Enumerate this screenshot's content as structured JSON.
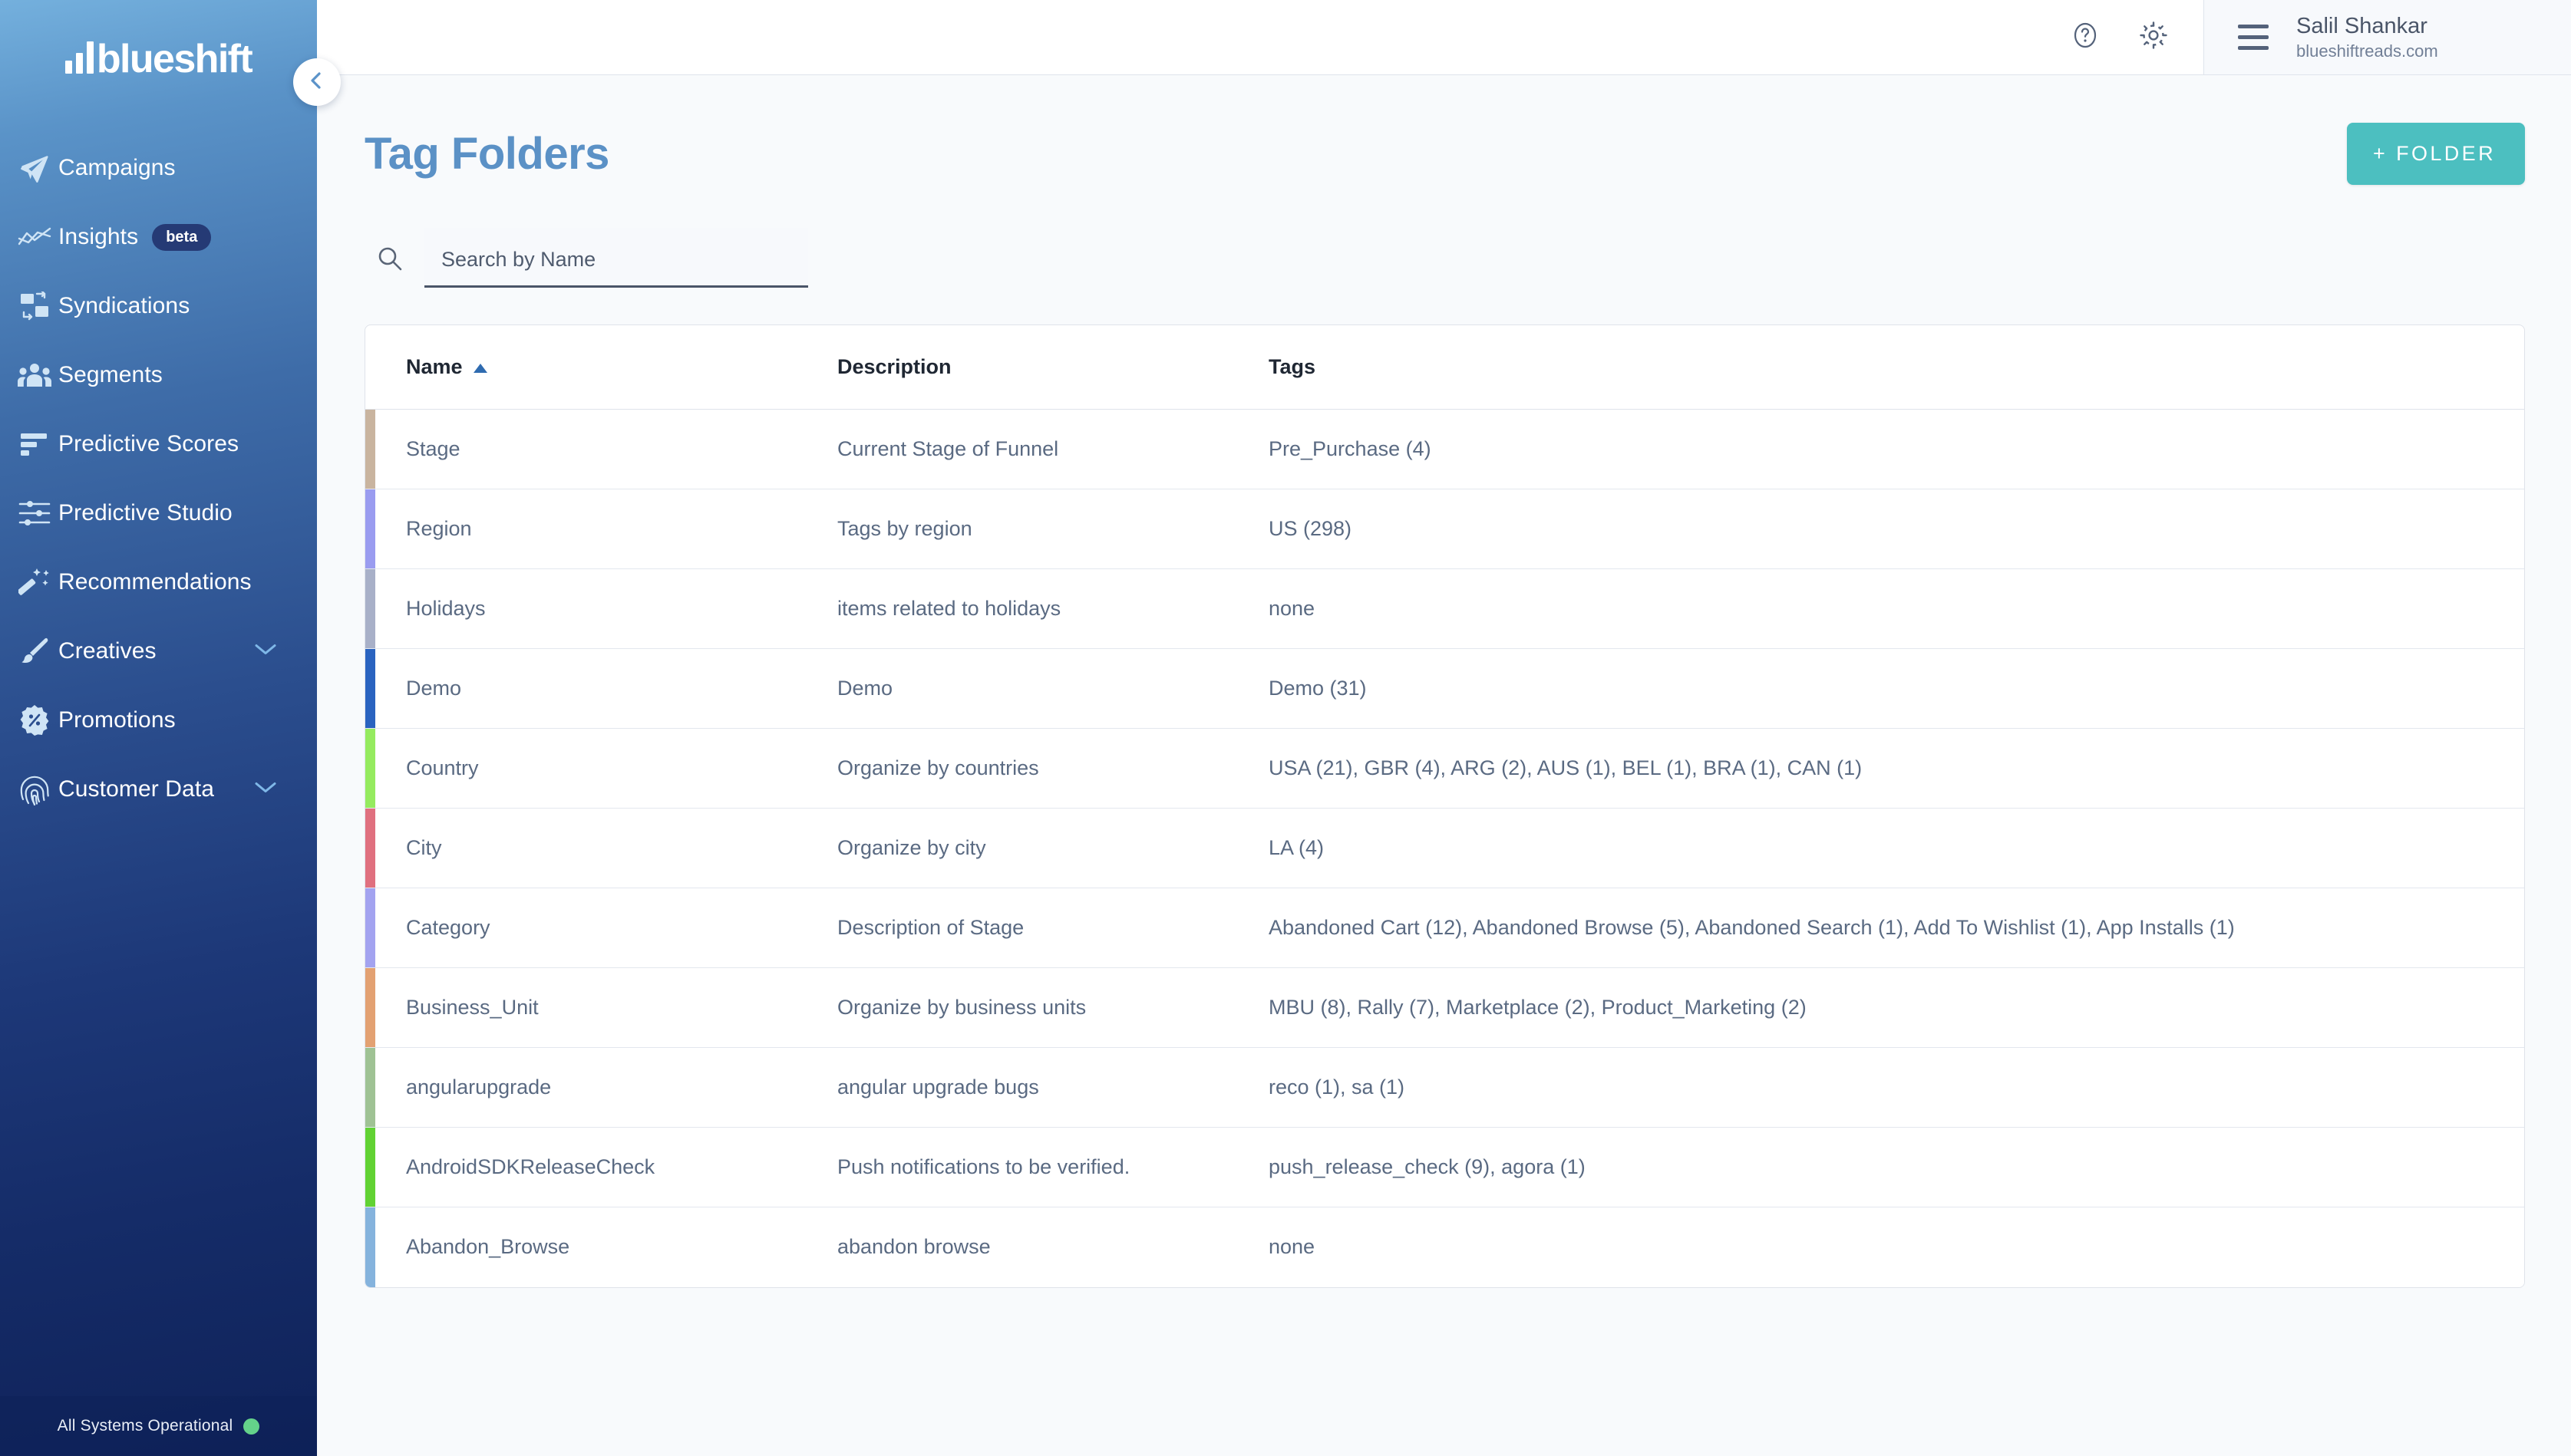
{
  "brand": {
    "name": "blueshift",
    "logo_icon": "bar-chart-logo-icon"
  },
  "sidebar": {
    "items": [
      {
        "label": "Campaigns",
        "icon": "paper-plane-icon",
        "badge": null,
        "caret": false
      },
      {
        "label": "Insights",
        "icon": "line-chart-icon",
        "badge": "beta",
        "caret": false
      },
      {
        "label": "Syndications",
        "icon": "syndication-icon",
        "badge": null,
        "caret": false
      },
      {
        "label": "Segments",
        "icon": "people-group-icon",
        "badge": null,
        "caret": false
      },
      {
        "label": "Predictive Scores",
        "icon": "bar-list-icon",
        "badge": null,
        "caret": false
      },
      {
        "label": "Predictive Studio",
        "icon": "sliders-icon",
        "badge": null,
        "caret": false
      },
      {
        "label": "Recommendations",
        "icon": "magic-wand-icon",
        "badge": null,
        "caret": false
      },
      {
        "label": "Creatives",
        "icon": "paintbrush-icon",
        "badge": null,
        "caret": true
      },
      {
        "label": "Promotions",
        "icon": "percent-badge-icon",
        "badge": null,
        "caret": false
      },
      {
        "label": "Customer Data",
        "icon": "fingerprint-icon",
        "badge": null,
        "caret": true
      }
    ],
    "collapse_icon": "chevron-left-icon",
    "status": {
      "text": "All Systems Operational",
      "dot_color": "#64d28a"
    }
  },
  "topbar": {
    "help_icon": "question-circle-icon",
    "settings_icon": "gear-icon",
    "menu_icon": "hamburger-icon",
    "user_name": "Salil Shankar",
    "user_site": "blueshiftreads.com"
  },
  "page": {
    "title": "Tag Folders",
    "add_button_label": "+ FOLDER",
    "add_button_color": "#4cbfc0",
    "title_color": "#5b91c6"
  },
  "search": {
    "placeholder": "Search by Name",
    "value": "",
    "icon": "search-icon"
  },
  "table": {
    "columns": [
      {
        "key": "name",
        "label": "Name",
        "sorted": true,
        "sort_dir": "asc",
        "sort_icon": "caret-up-icon"
      },
      {
        "key": "description",
        "label": "Description",
        "sorted": false,
        "sort_dir": null,
        "sort_icon": null
      },
      {
        "key": "tags",
        "label": "Tags",
        "sorted": false,
        "sort_dir": null,
        "sort_icon": null
      }
    ],
    "rows": [
      {
        "color": "#c9b49f",
        "name": "Stage",
        "description": "Current Stage of Funnel",
        "tags": "Pre_Purchase (4)"
      },
      {
        "color": "#9a9cf0",
        "name": "Region",
        "description": "Tags by region",
        "tags": "US (298)"
      },
      {
        "color": "#a8b0c8",
        "name": "Holidays",
        "description": "items related to holidays",
        "tags": "none"
      },
      {
        "color": "#2a63c0",
        "name": "Demo",
        "description": "Demo",
        "tags": "Demo (31)"
      },
      {
        "color": "#95eb5f",
        "name": "Country",
        "description": "Organize by countries",
        "tags": "USA (21), GBR (4), ARG (2), AUS (1), BEL (1), BRA (1), CAN (1)"
      },
      {
        "color": "#e0707f",
        "name": "City",
        "description": "Organize by city",
        "tags": "LA (4)"
      },
      {
        "color": "#a3a3f0",
        "name": "Category",
        "description": "Description of Stage",
        "tags": "Abandoned Cart (12), Abandoned Browse (5), Abandoned Search (1), Add To Wishlist (1), App Installs (1)"
      },
      {
        "color": "#e3a172",
        "name": "Business_Unit",
        "description": "Organize by business units",
        "tags": "MBU (8), Rally (7), Marketplace (2), Product_Marketing (2)"
      },
      {
        "color": "#9fc294",
        "name": "angularupgrade",
        "description": "angular upgrade bugs",
        "tags": "reco (1), sa (1)"
      },
      {
        "color": "#61d233",
        "name": "AndroidSDKReleaseCheck",
        "description": "Push notifications to be verified.",
        "tags": "push_release_check (9), agora (1)"
      },
      {
        "color": "#85b3dd",
        "name": "Abandon_Browse",
        "description": "abandon browse",
        "tags": "none"
      }
    ]
  }
}
